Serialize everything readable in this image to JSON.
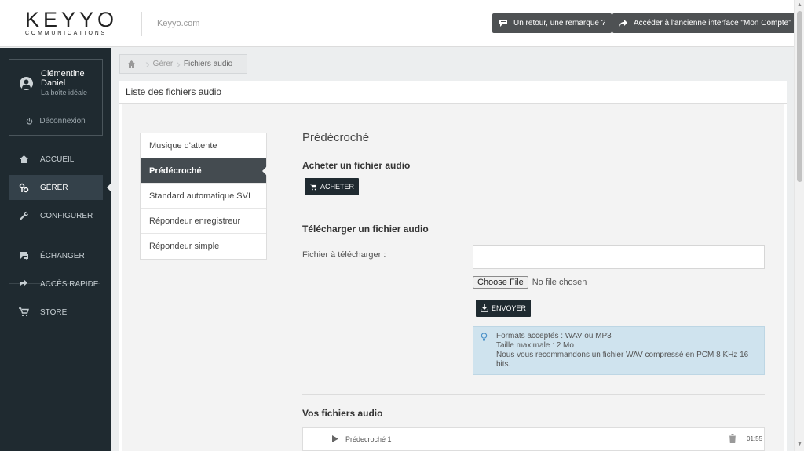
{
  "header": {
    "logo_main": "KEYYO",
    "logo_sub": "COMMUNICATIONS",
    "site_link": "Keyyo.com",
    "feedback_button": "Un retour, une remarque ?",
    "old_interface_button": "Accéder à l'ancienne interface \"Mon Compte\""
  },
  "user": {
    "first_name": "Clémentine",
    "last_name": "Daniel",
    "company": "La boîte idéale",
    "logout": "Déconnexion"
  },
  "sidebar": {
    "items": [
      {
        "label": "ACCUEIL",
        "icon": "home-icon"
      },
      {
        "label": "GÉRER",
        "icon": "manage-icon",
        "active": true
      },
      {
        "label": "CONFIGURER",
        "icon": "wrench-icon"
      },
      {
        "label": "ÉCHANGER",
        "icon": "chat-icon"
      },
      {
        "label": "ACCÈS RAPIDE",
        "icon": "shortcut-icon"
      },
      {
        "label": "STORE",
        "icon": "cart-icon"
      }
    ]
  },
  "breadcrumb": {
    "home_icon": "home-icon",
    "level1": "Gérer",
    "current": "Fichiers audio"
  },
  "panel": {
    "title": "Liste des fichiers audio"
  },
  "tabs": [
    {
      "label": "Musique d'attente"
    },
    {
      "label": "Prédécroché",
      "active": true
    },
    {
      "label": "Standard automatique SVI"
    },
    {
      "label": "Répondeur enregistreur"
    },
    {
      "label": "Répondeur simple"
    }
  ],
  "main": {
    "heading": "Prédécroché",
    "buy_title": "Acheter un fichier audio",
    "buy_button": "ACHETER",
    "upload_title": "Télécharger un fichier audio",
    "file_label": "Fichier à télécharger :",
    "file_input_value": "",
    "choose_file": "Choose File",
    "no_file": "No file chosen",
    "send_button": "ENVOYER",
    "info_lines": [
      "Formats acceptés : WAV ou MP3",
      "Taille maximale : 2 Mo",
      "Nous vous recommandons un fichier WAV compressé en PCM 8 KHz 16 bits."
    ],
    "files_title": "Vos fichiers audio",
    "files": [
      {
        "name": "Prédecroché 1",
        "duration": "01:55"
      }
    ]
  },
  "colors": {
    "sidebar_bg": "#1f2a30",
    "active_tab": "#444b50",
    "info_bg": "#cfe3ee",
    "top_button_bg": "#4e5153"
  }
}
